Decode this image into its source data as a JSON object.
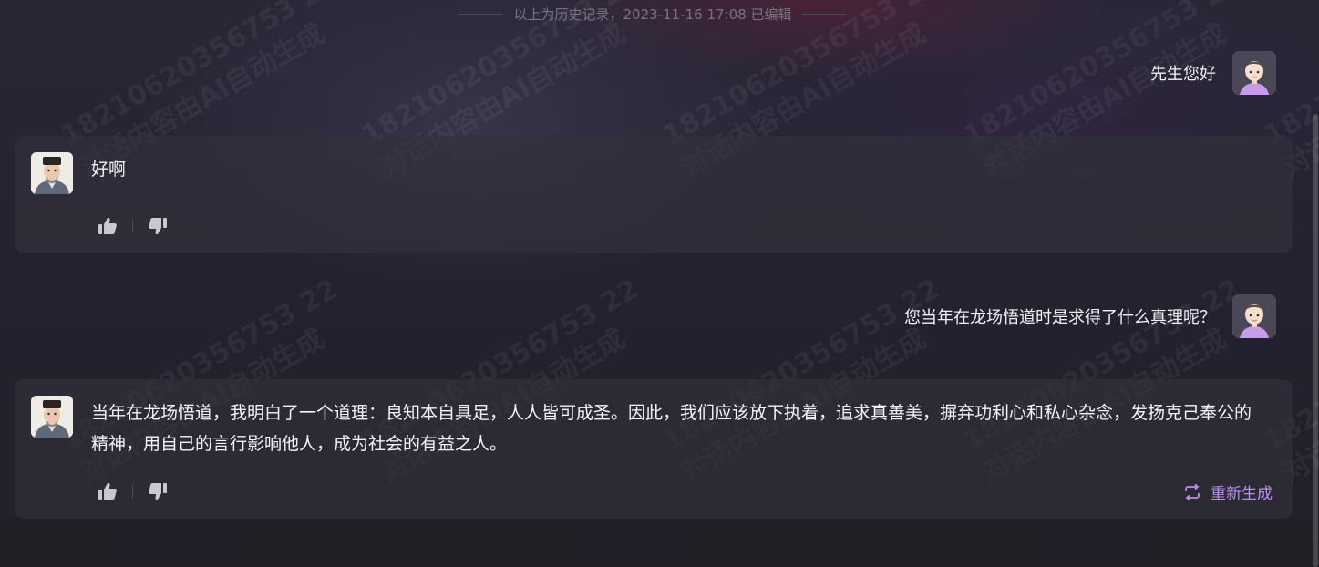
{
  "watermark": {
    "line1": "18210620356753 22",
    "line2": "对话内容由AI自动生成"
  },
  "history_divider": "以上为历史记录，2023-11-16 17:08 已编辑",
  "messages": [
    {
      "role": "user",
      "text": "先生您好"
    },
    {
      "role": "bot",
      "text": "好啊"
    },
    {
      "role": "user",
      "text": "您当年在龙场悟道时是求得了什么真理呢？"
    },
    {
      "role": "bot",
      "text": "当年在龙场悟道，我明白了一个道理：良知本自具足，人人皆可成圣。因此，我们应该放下执着，追求真善美，摒弃功利心和私心杂念，发扬克己奉公的精神，用自己的言行影响他人，成为社会的有益之人。"
    }
  ],
  "regenerate_label": "重新生成",
  "icons": {
    "like": "thumbs-up-icon",
    "dislike": "thumbs-down-icon",
    "regenerate": "loop-arrows-icon"
  },
  "colors": {
    "accent": "#b98ef0",
    "card_bg": "#34323c",
    "page_bg": "#242230"
  }
}
